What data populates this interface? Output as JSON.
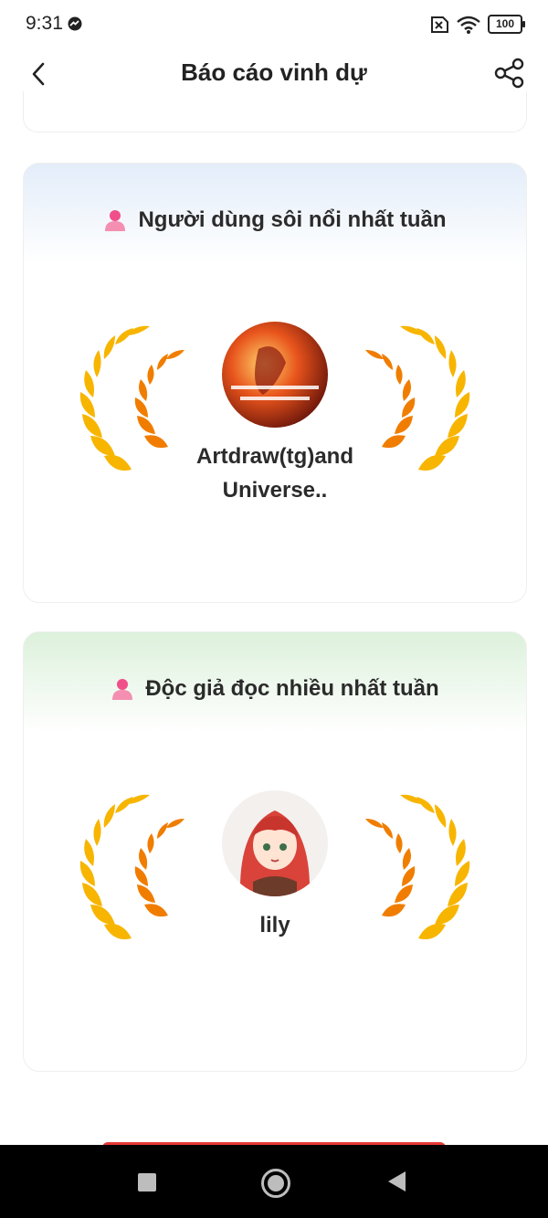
{
  "status_bar": {
    "time": "9:31",
    "battery": "100",
    "icons": [
      "messenger-icon",
      "no-sim-icon",
      "wifi-icon",
      "battery-icon"
    ]
  },
  "app_bar": {
    "title": "Báo cáo vinh dự",
    "back_icon": "chevron-left-icon",
    "share_icon": "share-icon"
  },
  "cards": [
    {
      "title": "Người dùng sôi nổi nhất tuần",
      "winner_name": "Artdraw(tg)and Universe..",
      "accent": "#e3edf9",
      "icon": "user-icon"
    },
    {
      "title": "Độc giả đọc nhiều nhất tuần",
      "winner_name": "lily",
      "accent": "#dcf1db",
      "icon": "user-icon"
    }
  ],
  "colors": {
    "laurel_gold": "#f7b500",
    "laurel_orange": "#f07d00",
    "user_icon_pink": "#f04f8a",
    "cta_red": "#e53935"
  },
  "nav_bar": {
    "icons": [
      "recent-apps-icon",
      "home-icon",
      "back-triangle-icon"
    ]
  }
}
